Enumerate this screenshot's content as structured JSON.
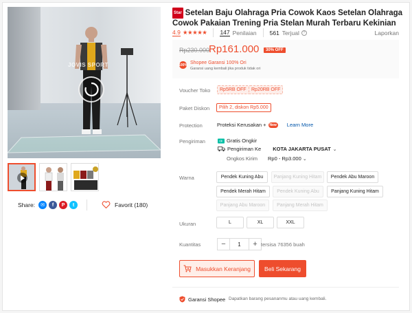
{
  "product": {
    "badge": "Star",
    "title": "Setelan Baju Olahraga Pria Cowok Kaos Setelan Olahraga Cowok Pakaian Trening Pria Stelan Murah Terbaru Kekinian",
    "rating": "4.9",
    "stars": "★★★★★",
    "review_count": "147",
    "review_label": "Penilaian",
    "sold_count": "561",
    "sold_label": "Terjual",
    "report_label": "Laporkan"
  },
  "price": {
    "original": "Rp230.000",
    "current": "Rp161.000",
    "discount": "30% OFF",
    "guarantee_icon": "shopee-guarantee-icon",
    "guarantee_title": "Shopee Garansi 100% Ori",
    "guarantee_sub": "Garansi uang kembali jika produk tidak ori"
  },
  "video": {
    "watermark": "JOVIS SPORT"
  },
  "share": {
    "label": "Share:",
    "favorite": "Favorit (180)"
  },
  "voucher": {
    "label": "Voucher Toko",
    "items": [
      "Rp5RB OFF",
      "Rp20RB OFF"
    ]
  },
  "bundle": {
    "label": "Paket Diskon",
    "value": "Pilih 2, diskon Rp5.000"
  },
  "protection": {
    "label": "Protection",
    "value": "Proteksi Kerusakan +",
    "badge": "New",
    "link": "Learn More"
  },
  "shipping": {
    "label": "Pengiriman",
    "free": "Gratis Ongkir",
    "to_label": "Pengiriman Ke",
    "destination": "KOTA JAKARTA PUSAT",
    "cost_label": "Ongkos Kirim",
    "cost_value": "Rp0 - Rp3.000"
  },
  "variants": {
    "color_label": "Warna",
    "colors": [
      {
        "label": "Pendek Kuning Abu",
        "disabled": false
      },
      {
        "label": "Panjang Kuning Hitam",
        "disabled": true
      },
      {
        "label": "Pendek Abu Maroon",
        "disabled": false
      },
      {
        "label": "Pendek Merah Hitam",
        "disabled": false
      },
      {
        "label": "Pendek Kuning Abu",
        "disabled": true
      },
      {
        "label": "Panjang Kuning Hitam",
        "disabled": false
      },
      {
        "label": "Panjang Abu Maroon",
        "disabled": true
      },
      {
        "label": "Panjang Merah Hitam",
        "disabled": true
      }
    ],
    "size_label": "Ukuran",
    "sizes": [
      "L",
      "XL",
      "XXL"
    ]
  },
  "quantity": {
    "label": "Kuantitas",
    "minus": "−",
    "value": "1",
    "plus": "+",
    "stock": "tersisa 76356 buah"
  },
  "actions": {
    "add_to_cart": "Masukkan Keranjang",
    "buy_now": "Beli Sekarang"
  },
  "footer": {
    "guarantee": "Garansi Shopee",
    "guarantee_desc": "Dapatkan barang pesananmu atau uang kembali."
  },
  "colors": {
    "accent": "#ee4d2d",
    "star_badge": "#d0011b"
  }
}
